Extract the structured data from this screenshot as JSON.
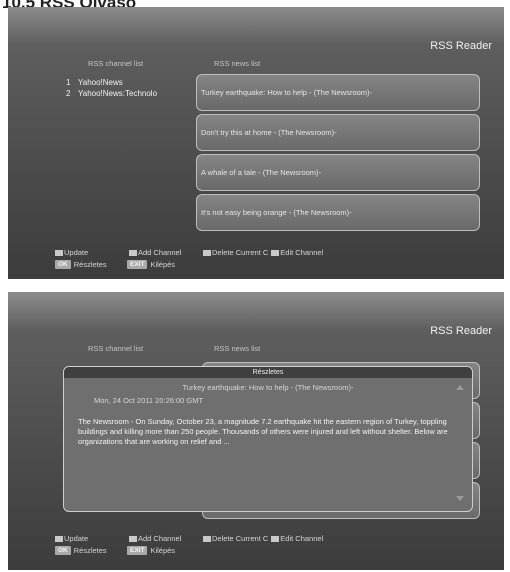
{
  "heading": "10.5 RSS Olvasó",
  "screen1": {
    "app_title": "RSS Reader",
    "channel_header": "RSS channel list",
    "news_header": "RSS news list",
    "channels": [
      {
        "num": "1",
        "name": "Yahoo!News"
      },
      {
        "num": "2",
        "name": "Yahoo!News:Technolo"
      }
    ],
    "news": [
      "Turkey earthquake: How to help -   (The Newsroom)-",
      "Don't try this at home -   (The Newsroom)-",
      "A whale of a tale -   (The Newsroom)-",
      "It's not easy being orange -   (The Newsroom)-"
    ],
    "legend": {
      "update": "Update",
      "add": "Add Channel",
      "delete": "Delete Current C",
      "edit": "Edit Channel",
      "ok_key": "OK",
      "ok_label": "Részletes",
      "exit_key": "EXIT",
      "exit_label": "Kilépés"
    },
    "colors": {
      "red_key": "#c9c9c9",
      "green_key": "#c9c9c9",
      "yellow_key": "#c9c9c9",
      "blue_key": "#c9c9c9"
    }
  },
  "screen2": {
    "app_title": "RSS Reader",
    "channel_header": "RSS channel list",
    "news_header": "RSS news list",
    "popup": {
      "title": "Részletes",
      "subtitle": "Turkey earthquake: How to help -   (The Newsroom)-",
      "date": "Mon, 24 Oct 2011 20:26:00 GMT",
      "body": "The Newsroom - On Sunday, October 23, a magnitude 7.2 earthquake hit the eastern region of Turkey, toppling buildings and killing more than 250 people. Thousands of others were injured and left without shelter. Below are organizations that are working on relief and ..."
    },
    "legend": {
      "update": "Update",
      "add": "Add Channel",
      "delete": "Delete Current C",
      "edit": "Edit Channel",
      "ok_key": "OK",
      "ok_label": "Részletes",
      "exit_key": "EXIT",
      "exit_label": "Kilépés"
    }
  }
}
